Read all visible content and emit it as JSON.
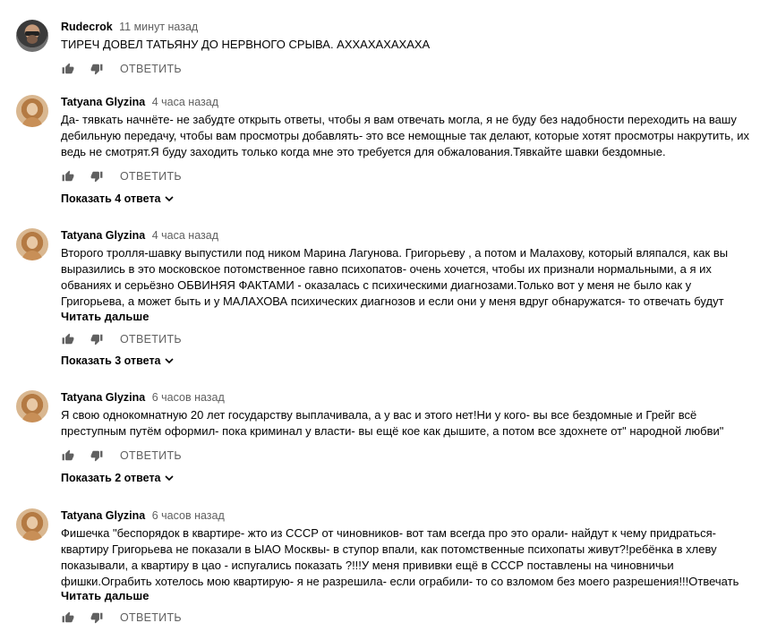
{
  "comments": [
    {
      "author": "Rudecrok",
      "time": "11 минут назад",
      "text": "ТИРЕЧ ДОВЕЛ ТАТЬЯНУ ДО НЕРВНОГО СРЫВА. АХХАХАХАХАХА",
      "reply_label": "ОТВЕТИТЬ"
    },
    {
      "author": "Tatyana Glyzina",
      "time": "4 часа назад",
      "text": "Да- тявкать начнёте- не забудте открыть ответы, чтобы я вам отвечать могла, я не буду без надобности переходить на вашу дебильную передачу, чтобы вам просмотры добавлять- это все немощные так делают, которые хотят просмотры накрутить, их ведь не смотрят.Я буду заходить только когда мне это требуется для обжалования.Тявкайте шавки бездомные.",
      "reply_label": "ОТВЕТИТЬ",
      "show_replies": "Показать 4 ответа"
    },
    {
      "author": "Tatyana Glyzina",
      "time": "4 часа назад",
      "text": "Второго тролля-шавку выпустили под ником  Марина Лагунова. Григорьеву , а потом и Малахову, который вляпался, как вы выразились в это московское потомственное гавно психопатов- очень хочется, чтобы их признали нормальными, а я их обваниях и серьёзно ОБВИНЯЯ ФАКТАМИ - оказалась с психическими диагнозами.Только вот у меня не было как у Григорьева, а может быть и у МАЛАХОВА психических диагнозов и если они у меня вдруг обнаружатся- то отвечать будут",
      "read_more": "Читать дальше",
      "reply_label": "ОТВЕТИТЬ",
      "show_replies": "Показать 3 ответа"
    },
    {
      "author": "Tatyana Glyzina",
      "time": "6 часов назад",
      "text": "Я свою однокомнатную 20 лет государству выплачивала, а у вас и этого нет!Ни у кого- вы все бездомные и Грейг всё преступным путём оформил- пока криминал у власти- вы ещё кое как дышите, а потом все здохнете от\" народной любви\"",
      "reply_label": "ОТВЕТИТЬ",
      "show_replies": "Показать 2 ответа"
    },
    {
      "author": "Tatyana Glyzina",
      "time": "6 часов назад",
      "text": "Фишечка \"беспорядок в квартире- жто из СССР от чиновников- вот там всегда про это орали- найдут к чему придраться- квартиру Григорьева не показали в ЫАО Москвы- в ступор впали, как потомственные психопаты живут?!ребёнка в хлеву показывали, а квартиру в цао - испугались показать ?!!!У меня прививки ещё в СССР поставлены на чиновничьи фишки.Ограбить хотелось мою квартирую- я не разрешила- если ограбили- то со взломом без моего разрешения!!!Отвечать",
      "read_more": "Читать дальше",
      "reply_label": "ОТВЕТИТЬ"
    }
  ]
}
